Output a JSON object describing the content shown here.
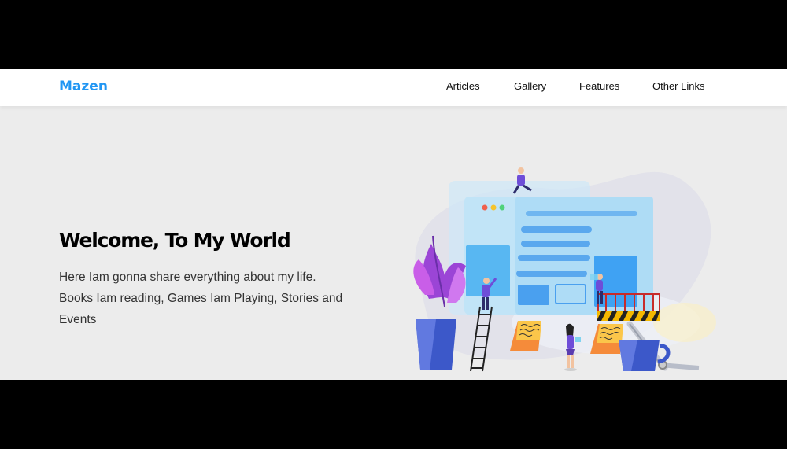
{
  "header": {
    "logo": "Mazen",
    "nav": [
      {
        "label": "Articles"
      },
      {
        "label": "Gallery"
      },
      {
        "label": "Features"
      },
      {
        "label": "Other Links"
      }
    ]
  },
  "hero": {
    "title": "Welcome, To My World",
    "line1": "Here Iam gonna share everything about my life.",
    "line2": "Books Iam reading, Games Iam Playing, Stories and",
    "line3": "Events"
  },
  "colors": {
    "brand": "#2196f3",
    "background": "#ececec",
    "header": "#ffffff"
  }
}
